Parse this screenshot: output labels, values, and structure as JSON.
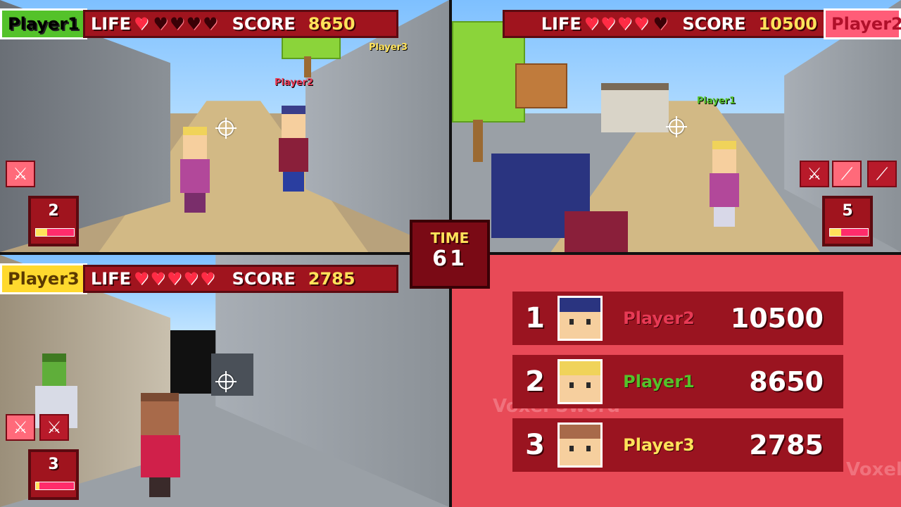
{
  "colors": {
    "player1": "#54c22a",
    "player2": "#e73a55",
    "player3": "#ffe25a",
    "hud_red": "#a0141e",
    "panel_bg": "#e84a57"
  },
  "timer": {
    "label": "TIME",
    "value": "61"
  },
  "players": [
    {
      "name": "Player1",
      "life_label": "LIFE",
      "hearts_full": "♥",
      "hearts_empty": "♥♥♥♥",
      "score_label": "SCORE",
      "score": "8650",
      "ammo": "2",
      "ammo_fraction": 0.3,
      "weapons": [
        "sword-icon"
      ],
      "visible_names": [
        "Player2",
        "Player3"
      ]
    },
    {
      "name": "Player2",
      "life_label": "LIFE",
      "hearts_full": "♥♥♥♥",
      "hearts_empty": "♥",
      "score_label": "SCORE",
      "score": "10500",
      "ammo": "5",
      "ammo_fraction": 0.3,
      "weapons": [
        "sword-icon",
        "spear-icon",
        "spear-icon"
      ],
      "visible_names": [
        "Player1"
      ]
    },
    {
      "name": "Player3",
      "life_label": "LIFE",
      "hearts_full": "♥♥♥♥♥",
      "hearts_empty": "",
      "score_label": "SCORE",
      "score": "2785",
      "ammo": "3",
      "ammo_fraction": 0.1,
      "weapons": [
        "sword-icon",
        "sword-icon"
      ],
      "visible_names": []
    }
  ],
  "ranking": [
    {
      "pos": "1",
      "name": "Player2",
      "score": "10500"
    },
    {
      "pos": "2",
      "name": "Player1",
      "score": "8650"
    },
    {
      "pos": "3",
      "name": "Player3",
      "score": "2785"
    }
  ],
  "panel_watermark": "Voxel Sword",
  "panel_watermark_short": "Voxel"
}
